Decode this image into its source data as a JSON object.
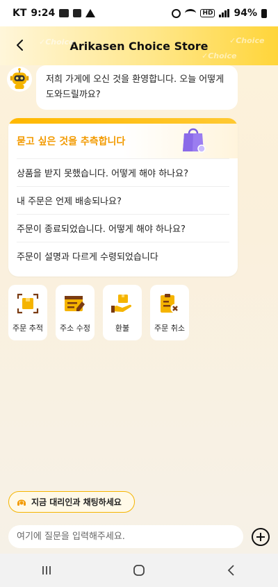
{
  "status_bar": {
    "carrier": "KT",
    "time": "9:24",
    "battery": "94%",
    "network": "HD"
  },
  "header": {
    "title": "Arikasen Choice Store",
    "watermark": "✓Choice"
  },
  "greeting": {
    "text": "저희 가게에 오신 것을 환영합니다. 오늘 어떻게 도와드릴까요?"
  },
  "suggestions": {
    "title": "묻고 싶은 것을 추측합니다",
    "items": [
      "상품을 받지 못했습니다. 어떻게 해야 하나요?",
      "내 주문은 언제 배송되나요?",
      "주문이 종료되었습니다. 어떻게 해야 하나요?",
      "주문이 설명과 다르게 수령되었습니다"
    ]
  },
  "actions": [
    {
      "label": "주문 추적",
      "icon": "order-track-icon"
    },
    {
      "label": "주소 수정",
      "icon": "address-edit-icon"
    },
    {
      "label": "환불",
      "icon": "refund-icon"
    },
    {
      "label": "주문 취소",
      "icon": "order-cancel-icon"
    }
  ],
  "agent_chat": {
    "label": "지금 대리인과 채팅하세요"
  },
  "input": {
    "placeholder": "여기에 질문을 입력해주세요."
  },
  "colors": {
    "accent": "#f5b400",
    "accent_text": "#f29a00",
    "header_gradient_end": "#ffd53a"
  }
}
